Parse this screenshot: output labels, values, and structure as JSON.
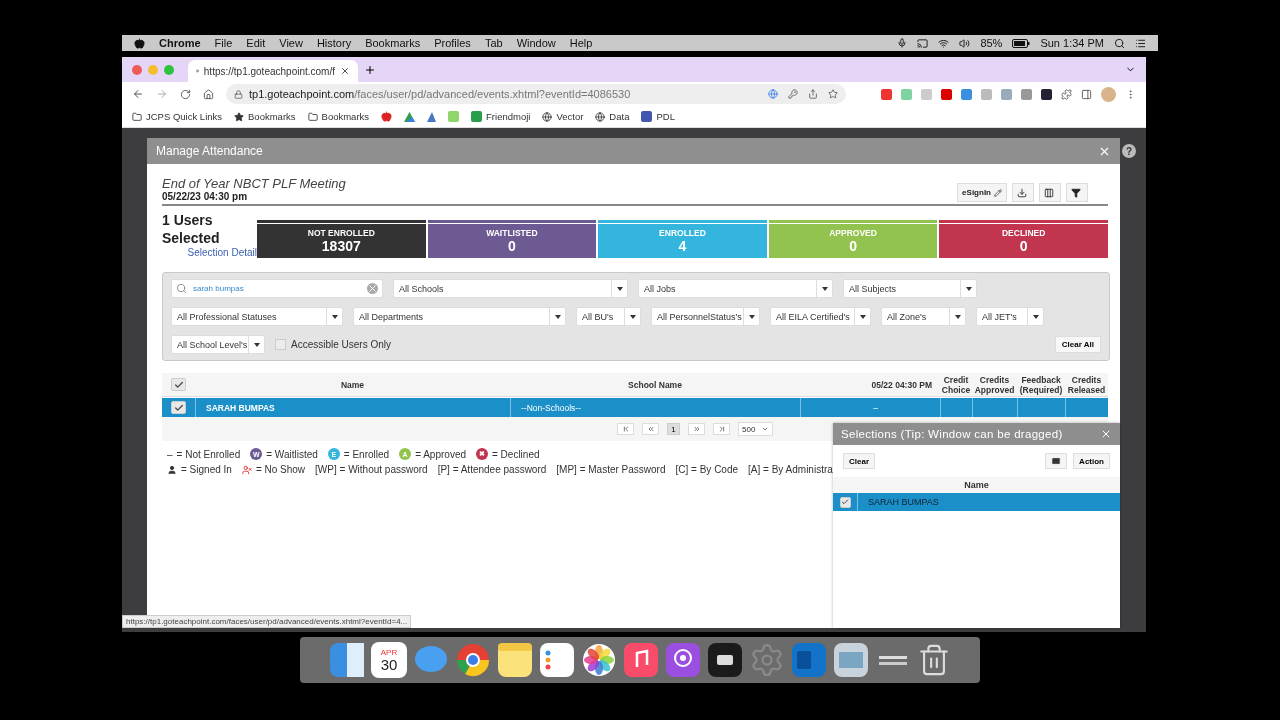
{
  "menubar": {
    "app_name": "Chrome",
    "items": [
      "File",
      "Edit",
      "View",
      "History",
      "Bookmarks",
      "Profiles",
      "Tab",
      "Window",
      "Help"
    ],
    "battery": "85%",
    "clock": "Sun 1:34 PM"
  },
  "browser": {
    "tab_title": "https://tp1.goteachpoint.com/f",
    "address_domain": "tp1.goteachpoint.com",
    "address_path": "/faces/user/pd/advanced/events.xhtml?eventId=4086530",
    "bookmarks": [
      {
        "kind": "folder",
        "label": "JCPS Quick Links"
      },
      {
        "kind": "star",
        "label": "Bookmarks"
      },
      {
        "kind": "folder",
        "label": "Bookmarks"
      },
      {
        "kind": "apple"
      },
      {
        "kind": "drive"
      },
      {
        "kind": "tent"
      },
      {
        "kind": "letter-c"
      },
      {
        "kind": "plus-square",
        "label": "Friendmoji"
      },
      {
        "kind": "globe",
        "label": "Vector"
      },
      {
        "kind": "globe",
        "label": "Data"
      },
      {
        "kind": "board",
        "label": "PDL"
      }
    ],
    "help": "?",
    "status_url": "https://tp1.goteachpoint.com/faces/user/pd/advanced/events.xhtml?eventId=4..."
  },
  "modal": {
    "title": "Manage Attendance",
    "event_title": "End of Year NBCT PLF Meeting",
    "event_date": "05/22/23 04:30 pm",
    "esignin_label": "eSignIn",
    "users_selected": "1 Users Selected",
    "selection_detail": "Selection Detail",
    "tiles": [
      {
        "label": "NOT ENROLLED",
        "count": "18307",
        "color": "#333333"
      },
      {
        "label": "WAITLISTED",
        "count": "0",
        "color": "#6e5a93"
      },
      {
        "label": "ENROLLED",
        "count": "4",
        "color": "#33b5de"
      },
      {
        "label": "APPROVED",
        "count": "0",
        "color": "#93c34f"
      },
      {
        "label": "DECLINED",
        "count": "0",
        "color": "#c1354f"
      }
    ],
    "search": {
      "value": "sarah bumpas"
    },
    "filter_rows": [
      [
        "All Schools",
        "All Jobs",
        "All Subjects"
      ],
      [
        "All Professional Statuses",
        "All Departments",
        "All BU's",
        "All PersonnelStatus's",
        "All EILA Certified's",
        "All Zone's",
        "All JET's"
      ],
      [
        "All School Level's"
      ]
    ],
    "accessible_only": {
      "label": "Accessible Users Only",
      "checked": false
    },
    "clear_all": "Clear All",
    "table": {
      "select_all_checked": true,
      "columns": [
        "Name",
        "School Name",
        "05/22 04:30 PM",
        "Credit Choice",
        "Credits Approved",
        "Feedback (Required)",
        "Credits Released"
      ],
      "rows": [
        {
          "checked": true,
          "selected": true,
          "cells": [
            "SARAH BUMPAS",
            "--Non-Schools--",
            "–",
            "",
            "",
            "",
            ""
          ]
        }
      ]
    },
    "pagination": {
      "page": "1",
      "page_size": "500"
    },
    "legend": [
      [
        {
          "kind": "dash",
          "symbol": "–",
          "text": "= Not Enrolled"
        },
        {
          "kind": "badge",
          "symbol": "W",
          "color": "#6e5a93",
          "text": "= Waitlisted"
        },
        {
          "kind": "badge",
          "symbol": "E",
          "color": "#33b5de",
          "text": "= Enrolled"
        },
        {
          "kind": "badge",
          "symbol": "A",
          "color": "#93c34f",
          "text": "= Approved"
        },
        {
          "kind": "badge",
          "symbol": "✖",
          "color": "#c1354f",
          "text": "= Declined"
        }
      ],
      [
        {
          "kind": "person",
          "text": "= Signed In"
        },
        {
          "kind": "no-show",
          "text": "= No Show"
        },
        {
          "kind": "plain",
          "text": "[WP] = Without password"
        },
        {
          "kind": "plain",
          "text": "[P] = Attendee password"
        },
        {
          "kind": "plain",
          "text": "[MP] = Master Password"
        },
        {
          "kind": "plain",
          "text": "[C] = By Code"
        },
        {
          "kind": "plain",
          "text": "[A] = By Administra"
        }
      ]
    ],
    "selections": {
      "title": "Selections (Tip: Window can be dragged)",
      "clear": "Clear",
      "actions": "Action",
      "column": "Name",
      "rows": [
        {
          "checked": true,
          "selected": true,
          "name": "SARAH BUMPAS"
        }
      ]
    }
  },
  "dock": [
    {
      "kind": "finder"
    },
    {
      "kind": "calendar",
      "month": "APR",
      "day": "30"
    },
    {
      "kind": "messages"
    },
    {
      "kind": "chrome"
    },
    {
      "kind": "notes"
    },
    {
      "kind": "reminders"
    },
    {
      "kind": "photos"
    },
    {
      "kind": "music"
    },
    {
      "kind": "podcasts"
    },
    {
      "kind": "tv"
    },
    {
      "kind": "settings"
    },
    {
      "kind": "outlook"
    },
    {
      "kind": "preview"
    },
    {
      "kind": "dash"
    },
    {
      "kind": "trash"
    }
  ]
}
